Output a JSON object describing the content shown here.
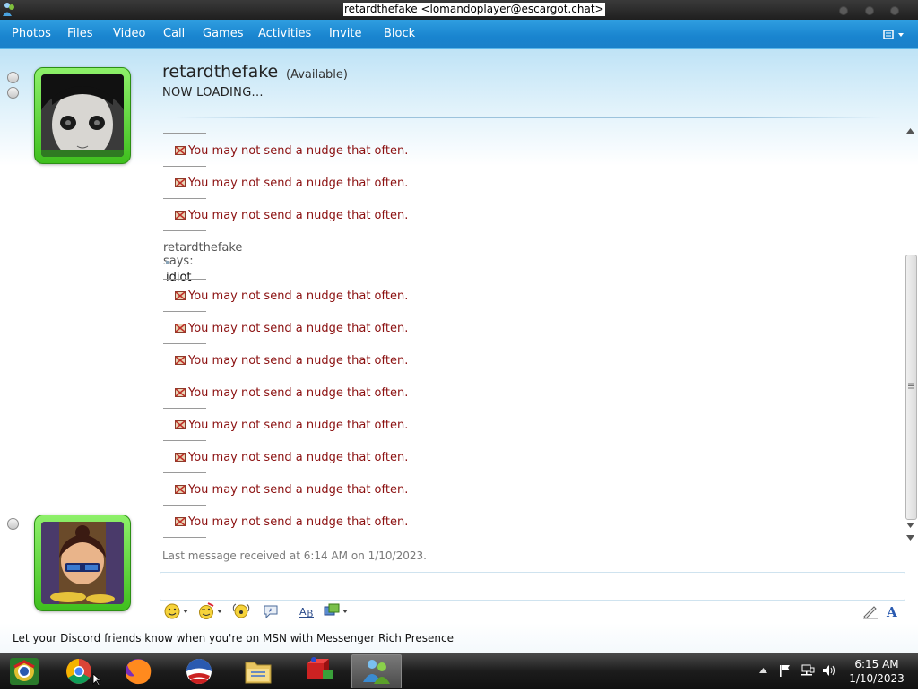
{
  "window": {
    "title": "retardthefake <lomandoplayer@escargot.chat>"
  },
  "menu": {
    "items": [
      "Photos",
      "Files",
      "Video",
      "Call",
      "Games",
      "Activities",
      "Invite",
      "Block"
    ]
  },
  "contact": {
    "name": "retardthefake",
    "status": "(Available)",
    "personal_message": "NOW LOADING..."
  },
  "history": {
    "nudge_text": "You may not send a nudge that often.",
    "says_label": "retardthefake says:",
    "message": "idiot"
  },
  "last_message_info": "Last message received at 6:14 AM on 1/10/2023.",
  "ad_text": "Let your Discord friends know when you're on MSN with Messenger Rich Presence",
  "taskbar": {
    "apps": [
      "chrome-icon",
      "chrome-icon",
      "firefox-icon",
      "obama-icon",
      "explorer-icon",
      "paint-icon",
      "messenger-icon"
    ],
    "clock_time": "6:15 AM",
    "clock_date": "1/10/2023"
  },
  "colors": {
    "menubar": "#1a86d0",
    "nudge_text": "#8b1010",
    "avatar_frame": "#4ccf25"
  }
}
